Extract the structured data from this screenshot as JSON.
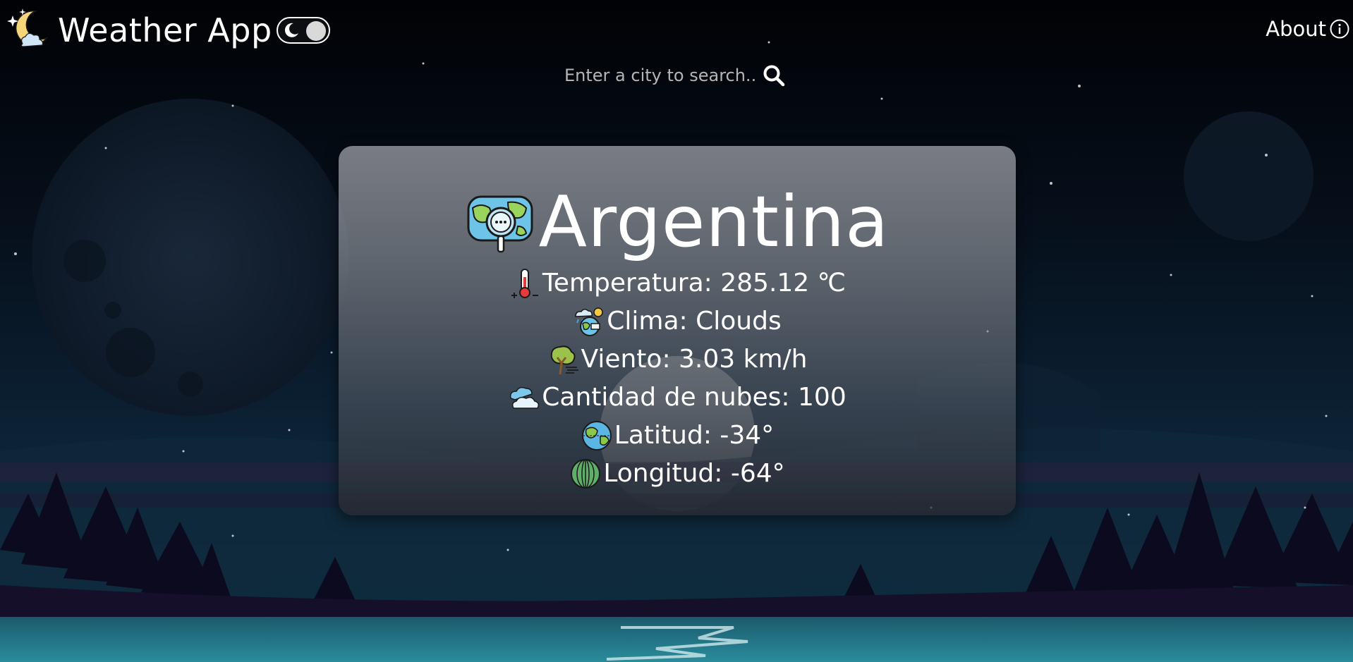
{
  "header": {
    "app_title": "Weather App",
    "about_label": "About"
  },
  "search": {
    "placeholder": "Enter a city to search..."
  },
  "card": {
    "city": "Argentina",
    "rows": [
      {
        "text": "Temperatura: 285.12 ℃",
        "icon": "thermometer-icon"
      },
      {
        "text": "Clima: Clouds",
        "icon": "weather-icon"
      },
      {
        "text": "Viento: 3.03 km/h",
        "icon": "wind-tree-icon"
      },
      {
        "text": "Cantidad de nubes: 100",
        "icon": "cloud-icon"
      },
      {
        "text": "Latitud: -34°",
        "icon": "earth-icon"
      },
      {
        "text": "Longitud: -64°",
        "icon": "globe-longitude-icon"
      }
    ]
  },
  "colors": {
    "sky_top": "#020409",
    "sky_mid": "#0b1a2c",
    "water": "#1c6f80",
    "accent_white": "#ffffff"
  }
}
